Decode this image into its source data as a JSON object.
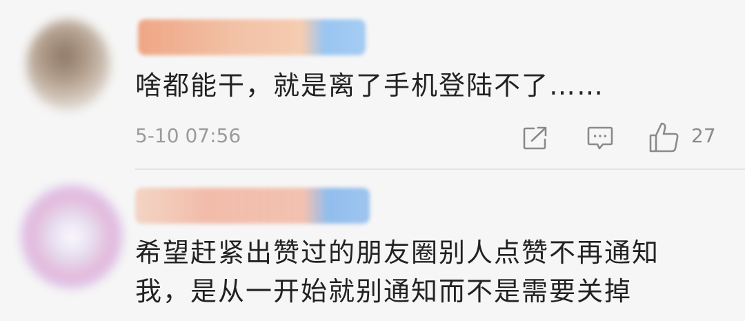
{
  "comments": [
    {
      "text": "啥都能干，就是离了手机登陆不了……",
      "timestamp": "5-10 07:56",
      "like_count": "27"
    },
    {
      "text": "希望赶紧出赞过的朋友圈别人点赞不再通知我，是从一开始就别通知而不是需要关掉"
    }
  ],
  "colors": {
    "background": "#f6f6f6",
    "text": "#222222",
    "meta": "#9b9b9b",
    "icon": "#8a8a8a"
  },
  "icons": [
    "share-icon",
    "comment-icon",
    "like-icon"
  ]
}
